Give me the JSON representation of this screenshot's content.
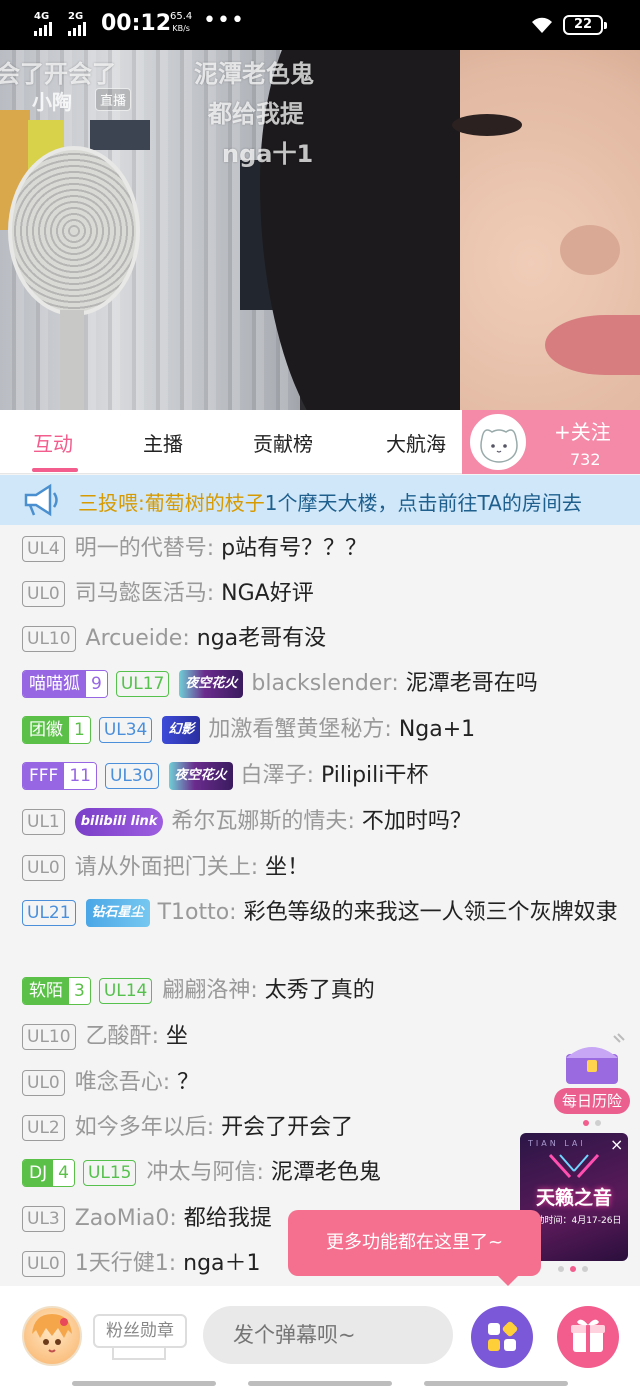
{
  "status_bar": {
    "net1": "4G",
    "net2": "2G",
    "time": "00:12",
    "speed_value": "65.4",
    "speed_unit": "KB/s",
    "dots": "•••",
    "battery": "22"
  },
  "video": {
    "live_name": "小陶",
    "live_badge": "直播",
    "overlay_danmaku": [
      "会了开会了",
      "泥潭老色鬼",
      "都给我提",
      "nga十1"
    ]
  },
  "tabs": [
    {
      "label": "互动",
      "active": true
    },
    {
      "label": "主播",
      "active": false
    },
    {
      "label": "贡献榜",
      "active": false
    },
    {
      "label": "大航海",
      "active": false
    }
  ],
  "follow": {
    "label": "+关注",
    "count": "732"
  },
  "notice": {
    "prefix": "三投喂:",
    "user": "葡萄树的枝子",
    "text": "1个摩天大楼，点击前往TA的房间去"
  },
  "chat": [
    {
      "ul": "UL4",
      "ul_style": "gray",
      "user": "明一的代替号",
      "msg": "p站有号？？？"
    },
    {
      "ul": "UL0",
      "ul_style": "gray",
      "user": "司马懿医活马",
      "msg": "NGA好评"
    },
    {
      "ul": "UL10",
      "ul_style": "gray",
      "user": "Arcueide",
      "msg": "nga老哥有没"
    },
    {
      "medal": "喵喵狐",
      "medal_lv": "9",
      "medal_style": "purple",
      "ul": "UL17",
      "ul_style": "green",
      "title_badge": "夜空花火",
      "user": "blackslender",
      "msg": "泥潭老哥在吗"
    },
    {
      "medal": "团徽",
      "medal_lv": "1",
      "medal_style": "green",
      "ul": "UL34",
      "ul_style": "blue",
      "title_badge": "幻影",
      "user": "加激看蟹黄堡秘方",
      "msg": "Nga+1"
    },
    {
      "medal": "FFF",
      "medal_lv": "11",
      "medal_style": "purple",
      "ul": "UL30",
      "ul_style": "blue",
      "title_badge": "夜空花火",
      "user": "白澤子",
      "msg": "Pilipili干杯"
    },
    {
      "ul": "UL1",
      "ul_style": "gray",
      "title_badge": "bilibili link",
      "user": "希尔瓦娜斯的情夫",
      "msg": "不加时吗？"
    },
    {
      "ul": "UL0",
      "ul_style": "gray",
      "user": "请从外面把门关上",
      "msg": "坐！"
    },
    {
      "ul": "UL21",
      "ul_style": "blue",
      "title_badge": "钻石星尘",
      "user": "T1otto",
      "msg": "彩色等级的来我这一人领三个灰牌奴隶"
    },
    {
      "medal": "软陌",
      "medal_lv": "3",
      "medal_style": "green",
      "ul": "UL14",
      "ul_style": "green",
      "user": "翩翩洛神",
      "msg": "太秀了真的"
    },
    {
      "ul": "UL10",
      "ul_style": "gray",
      "user": "乙酸酐",
      "msg": "坐"
    },
    {
      "ul": "UL0",
      "ul_style": "gray",
      "user": "唯念吾心",
      "msg": "？"
    },
    {
      "ul": "UL2",
      "ul_style": "gray",
      "user": "如今多年以后",
      "msg": "开会了开会了"
    },
    {
      "medal": "DJ",
      "medal_lv": "4",
      "medal_style": "green",
      "ul": "UL15",
      "ul_style": "green",
      "user": "冲太与阿信",
      "msg": "泥潭老色鬼"
    },
    {
      "ul": "UL3",
      "ul_style": "gray",
      "user": "ZaoMia0",
      "msg": "都给我提"
    },
    {
      "ul": "UL0",
      "ul_style": "gray",
      "user": "1天行健1",
      "msg": "nga＋1"
    }
  ],
  "widgets": {
    "daily_label": "每日历险",
    "ad_top": "TIAN LAI",
    "ad_title": "天籁之音",
    "ad_sub": "活动时间：4月17-26日",
    "ad_close": "×",
    "tooltip": "更多功能都在这里了~"
  },
  "bottom": {
    "fans_medal": "粉丝勋章",
    "danmaku_placeholder": "发个弹幕呗~"
  },
  "colors": {
    "accent": "#f25d8e",
    "notice_bg": "#cfe7f8",
    "follow_bg": "#f58aa8"
  }
}
